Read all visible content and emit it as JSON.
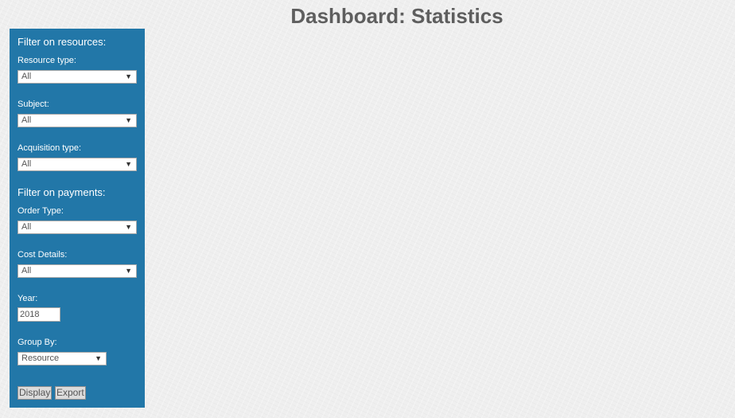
{
  "page": {
    "title": "Dashboard: Statistics"
  },
  "sidebar": {
    "resources_heading": "Filter on resources:",
    "payments_heading": "Filter on payments:",
    "resource_type": {
      "label": "Resource type:",
      "value": "All"
    },
    "subject": {
      "label": "Subject:",
      "value": "All"
    },
    "acquisition_type": {
      "label": "Acquisition type:",
      "value": "All"
    },
    "order_type": {
      "label": "Order Type:",
      "value": "All"
    },
    "cost_details": {
      "label": "Cost Details:",
      "value": "All"
    },
    "year": {
      "label": "Year:",
      "value": "2018"
    },
    "group_by": {
      "label": "Group By:",
      "value": "Resource"
    },
    "display_button": "Display",
    "export_button": "Export"
  },
  "icons": {
    "dropdown": "triangle-down-icon"
  },
  "colors": {
    "sidebar_background": "#2277a8",
    "page_background": "#efefef",
    "title_text": "#5e5e5e"
  }
}
